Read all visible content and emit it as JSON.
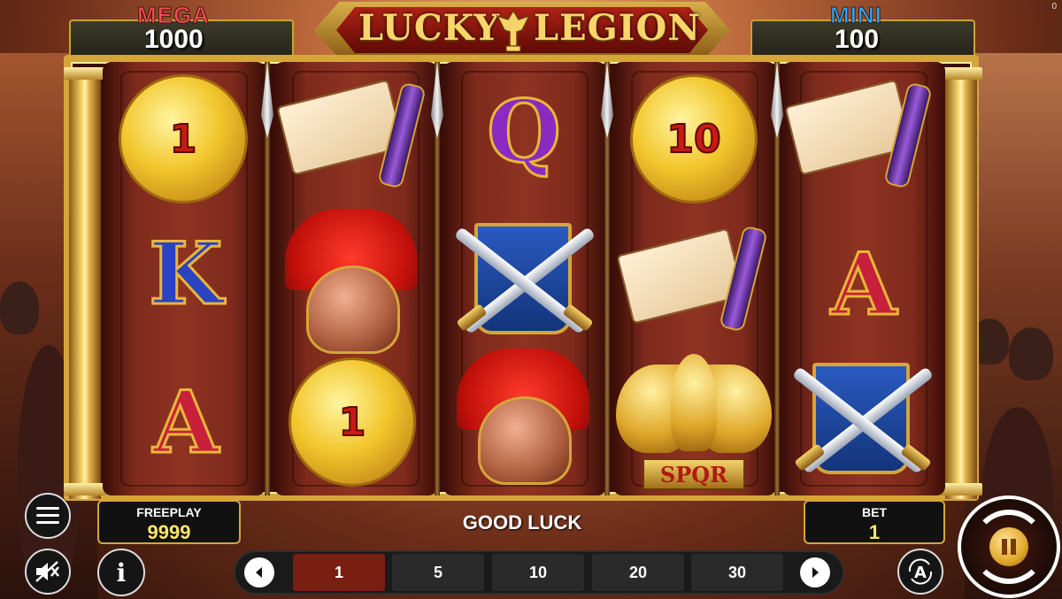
{
  "jackpots": {
    "mega": {
      "label": "MEGA",
      "value": "1000",
      "color": "#ff4a5a"
    },
    "mini": {
      "label": "MINI",
      "value": "100",
      "color": "#2aa8ff"
    }
  },
  "logo": {
    "word1": "LUCKY",
    "word2": "LEGION"
  },
  "reels": [
    {
      "symbols": [
        "coin",
        "K",
        "A"
      ],
      "coin_value": "1"
    },
    {
      "symbols": [
        "scroll",
        "helmet",
        "coin"
      ],
      "coin_value": "1"
    },
    {
      "symbols": [
        "Q",
        "crossed-swords-shield",
        "helmet"
      ]
    },
    {
      "symbols": [
        "coin",
        "scroll",
        "eagle-spqr"
      ],
      "coin_value": "10"
    },
    {
      "symbols": [
        "scroll",
        "A",
        "crossed-swords-shield"
      ]
    }
  ],
  "letters": {
    "K": "K",
    "A": "A",
    "Q": "Q"
  },
  "spqr_text": "SPQR",
  "freeplay": {
    "label": "FREEPLAY",
    "value": "9999"
  },
  "status_text": "GOOD LUCK",
  "bet": {
    "label": "BET",
    "value": "1"
  },
  "bet_options": [
    "1",
    "5",
    "10",
    "20",
    "30"
  ],
  "selected_bet_index": 0,
  "corner_indicator": "0",
  "icons": {
    "menu": "hamburger-icon",
    "sound": "speaker-muted-icon",
    "info": "info-icon",
    "auto": "autoplay-a-icon",
    "spin": "spin-arrows-icon",
    "pause": "pause-icon"
  }
}
